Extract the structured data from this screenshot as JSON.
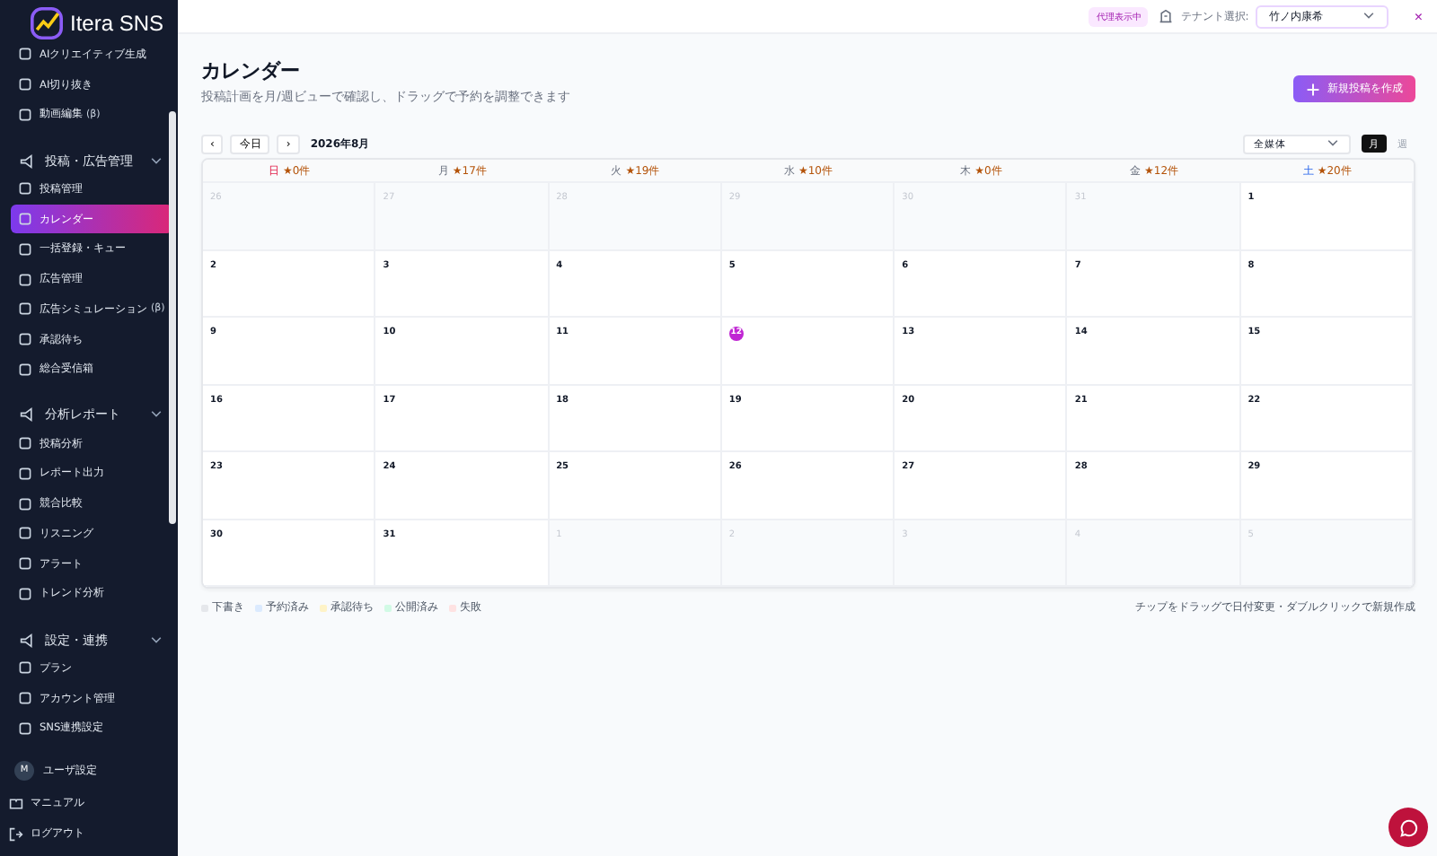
{
  "sidebar": {
    "logo": "Itera SNS",
    "items": [
      {
        "kind": "item",
        "label": "AIクリエイティブ生成",
        "selected": false
      },
      {
        "kind": "item",
        "label": "AI切り抜き",
        "selected": false
      },
      {
        "kind": "item",
        "label": "動画編集",
        "badge": "(β)",
        "selected": false
      },
      {
        "kind": "section",
        "label": "投稿・広告管理",
        "expanded": true
      },
      {
        "kind": "item",
        "label": "投稿管理",
        "selected": false
      },
      {
        "kind": "item",
        "label": "カレンダー",
        "selected": true
      },
      {
        "kind": "item",
        "label": "一括登録・キュー",
        "selected": false
      },
      {
        "kind": "item",
        "label": "広告管理",
        "selected": false
      },
      {
        "kind": "item",
        "label": "広告シミュレーション",
        "badge": "(β)",
        "selected": false
      },
      {
        "kind": "item",
        "label": "承認待ち",
        "selected": false
      },
      {
        "kind": "item",
        "label": "総合受信箱",
        "selected": false
      },
      {
        "kind": "section",
        "label": "分析レポート",
        "expanded": true
      },
      {
        "kind": "item",
        "label": "投稿分析",
        "selected": false
      },
      {
        "kind": "item",
        "label": "レポート出力",
        "selected": false
      },
      {
        "kind": "item",
        "label": "競合比較",
        "selected": false
      },
      {
        "kind": "item",
        "label": "リスニング",
        "selected": false
      },
      {
        "kind": "item",
        "label": "アラート",
        "selected": false
      },
      {
        "kind": "item",
        "label": "トレンド分析",
        "selected": false
      },
      {
        "kind": "section",
        "label": "設定・連携",
        "expanded": true
      },
      {
        "kind": "item",
        "label": "プラン",
        "selected": false
      },
      {
        "kind": "item",
        "label": "アカウント管理",
        "selected": false
      },
      {
        "kind": "item",
        "label": "SNS連携設定",
        "selected": false
      }
    ],
    "user": {
      "initial": "M",
      "label": "ユーザ設定"
    },
    "footer": [
      "マニュアル",
      "ログアウト"
    ]
  },
  "topbar": {
    "badge": "代理表示中",
    "tenant_label": "テナント選択:",
    "tenant_value": "竹ノ内康希",
    "close": "×"
  },
  "page": {
    "title": "カレンダー",
    "subtitle": "投稿計画を月/週ビューで確認し、ドラッグで予約を調整できます",
    "create_button": "新規投稿を作成"
  },
  "toolbar": {
    "prev": "‹",
    "today": "今日",
    "next": "›",
    "month": "2026年8月",
    "filter": "全媒体",
    "views": [
      {
        "label": "月",
        "selected": true
      },
      {
        "label": "週",
        "selected": false
      }
    ]
  },
  "calendar": {
    "weekdays": [
      {
        "label": "日",
        "count": "★0件",
        "kind": "sun"
      },
      {
        "label": "月",
        "count": "★17件",
        "kind": "weekday"
      },
      {
        "label": "火",
        "count": "★19件",
        "kind": "weekday"
      },
      {
        "label": "水",
        "count": "★10件",
        "kind": "weekday"
      },
      {
        "label": "木",
        "count": "★0件",
        "kind": "weekday"
      },
      {
        "label": "金",
        "count": "★12件",
        "kind": "weekday"
      },
      {
        "label": "土",
        "count": "★20件",
        "kind": "sat"
      }
    ],
    "weeks": [
      [
        {
          "day": "26",
          "in_month": false,
          "today": false
        },
        {
          "day": "27",
          "in_month": false,
          "today": false
        },
        {
          "day": "28",
          "in_month": false,
          "today": false
        },
        {
          "day": "29",
          "in_month": false,
          "today": false
        },
        {
          "day": "30",
          "in_month": false,
          "today": false
        },
        {
          "day": "31",
          "in_month": false,
          "today": false
        },
        {
          "day": "1",
          "in_month": true,
          "today": false
        }
      ],
      [
        {
          "day": "2",
          "in_month": true,
          "today": false
        },
        {
          "day": "3",
          "in_month": true,
          "today": false
        },
        {
          "day": "4",
          "in_month": true,
          "today": false
        },
        {
          "day": "5",
          "in_month": true,
          "today": false
        },
        {
          "day": "6",
          "in_month": true,
          "today": false
        },
        {
          "day": "7",
          "in_month": true,
          "today": false
        },
        {
          "day": "8",
          "in_month": true,
          "today": false
        }
      ],
      [
        {
          "day": "9",
          "in_month": true,
          "today": false
        },
        {
          "day": "10",
          "in_month": true,
          "today": false
        },
        {
          "day": "11",
          "in_month": true,
          "today": false
        },
        {
          "day": "12",
          "in_month": true,
          "today": true
        },
        {
          "day": "13",
          "in_month": true,
          "today": false
        },
        {
          "day": "14",
          "in_month": true,
          "today": false
        },
        {
          "day": "15",
          "in_month": true,
          "today": false
        }
      ],
      [
        {
          "day": "16",
          "in_month": true,
          "today": false
        },
        {
          "day": "17",
          "in_month": true,
          "today": false
        },
        {
          "day": "18",
          "in_month": true,
          "today": false
        },
        {
          "day": "19",
          "in_month": true,
          "today": false
        },
        {
          "day": "20",
          "in_month": true,
          "today": false
        },
        {
          "day": "21",
          "in_month": true,
          "today": false
        },
        {
          "day": "22",
          "in_month": true,
          "today": false
        }
      ],
      [
        {
          "day": "23",
          "in_month": true,
          "today": false
        },
        {
          "day": "24",
          "in_month": true,
          "today": false
        },
        {
          "day": "25",
          "in_month": true,
          "today": false
        },
        {
          "day": "26",
          "in_month": true,
          "today": false
        },
        {
          "day": "27",
          "in_month": true,
          "today": false
        },
        {
          "day": "28",
          "in_month": true,
          "today": false
        },
        {
          "day": "29",
          "in_month": true,
          "today": false
        }
      ],
      [
        {
          "day": "30",
          "in_month": true,
          "today": false
        },
        {
          "day": "31",
          "in_month": true,
          "today": false
        },
        {
          "day": "1",
          "in_month": false,
          "today": false
        },
        {
          "day": "2",
          "in_month": false,
          "today": false
        },
        {
          "day": "3",
          "in_month": false,
          "today": false
        },
        {
          "day": "4",
          "in_month": false,
          "today": false
        },
        {
          "day": "5",
          "in_month": false,
          "today": false
        }
      ]
    ]
  },
  "legend": [
    {
      "label": "下書き",
      "color": "#e5e7eb"
    },
    {
      "label": "予約済み",
      "color": "#dbeafe"
    },
    {
      "label": "承認待ち",
      "color": "#fef3c7"
    },
    {
      "label": "公開済み",
      "color": "#d1fae5"
    },
    {
      "label": "失敗",
      "color": "#fee2e2"
    }
  ],
  "hint": "チップをドラッグで日付変更・ダブルクリックで新規作成"
}
